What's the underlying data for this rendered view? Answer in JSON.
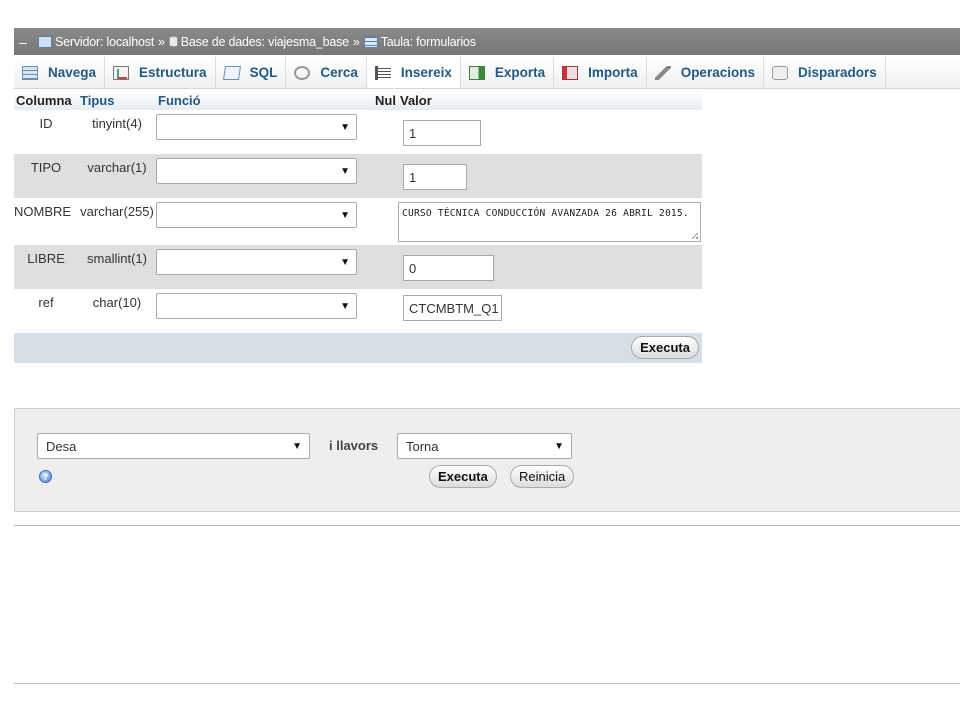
{
  "breadcrumb": {
    "collapse_symbol": "–",
    "server": "Servidor: localhost",
    "sep1": "»",
    "database": "Base de dades: viajesma_base",
    "sep2": "»",
    "table": "Taula: formularios"
  },
  "tabs": [
    {
      "label": "Navega",
      "icon": "browse-icon"
    },
    {
      "label": "Estructura",
      "icon": "structure-icon"
    },
    {
      "label": "SQL",
      "icon": "sql-icon"
    },
    {
      "label": "Cerca",
      "icon": "search-icon"
    },
    {
      "label": "Insereix",
      "icon": "insert-icon",
      "active": true
    },
    {
      "label": "Exporta",
      "icon": "export-icon"
    },
    {
      "label": "Importa",
      "icon": "import-icon"
    },
    {
      "label": "Operacions",
      "icon": "wrench-icon"
    },
    {
      "label": "Disparadors",
      "icon": "triggers-icon"
    }
  ],
  "form": {
    "headers": {
      "column": "Columna",
      "type": "Tipus",
      "function": "Funció",
      "null": "Nul",
      "value": "Valor"
    },
    "rows": [
      {
        "column": "ID",
        "type": "tinyint(4)",
        "function": "",
        "value": "1"
      },
      {
        "column": "TIPO",
        "type": "varchar(1)",
        "function": "",
        "value": "1"
      },
      {
        "column": "NOMBRE",
        "type": "varchar(255)",
        "function": "",
        "value": "CURSO TÉCNICA CONDUCCIÓN AVANZADA 26 ABRIL 2015."
      },
      {
        "column": "LIBRE",
        "type": "smallint(1)",
        "function": "",
        "value": "0"
      },
      {
        "column": "ref",
        "type": "char(10)",
        "function": "",
        "value": "CTCMBTM_Q1"
      }
    ],
    "execute_label": "Executa"
  },
  "after": {
    "action_select": "Desa",
    "and_then_label": "i llavors",
    "then_select": "Torna",
    "execute_label": "Executa",
    "reset_label": "Reinicia"
  },
  "dropdown_arrow": "▼",
  "colors": {
    "tab_text": "#235a81",
    "topbar": "#7e7e7e",
    "footer_row": "#d7dee6"
  }
}
